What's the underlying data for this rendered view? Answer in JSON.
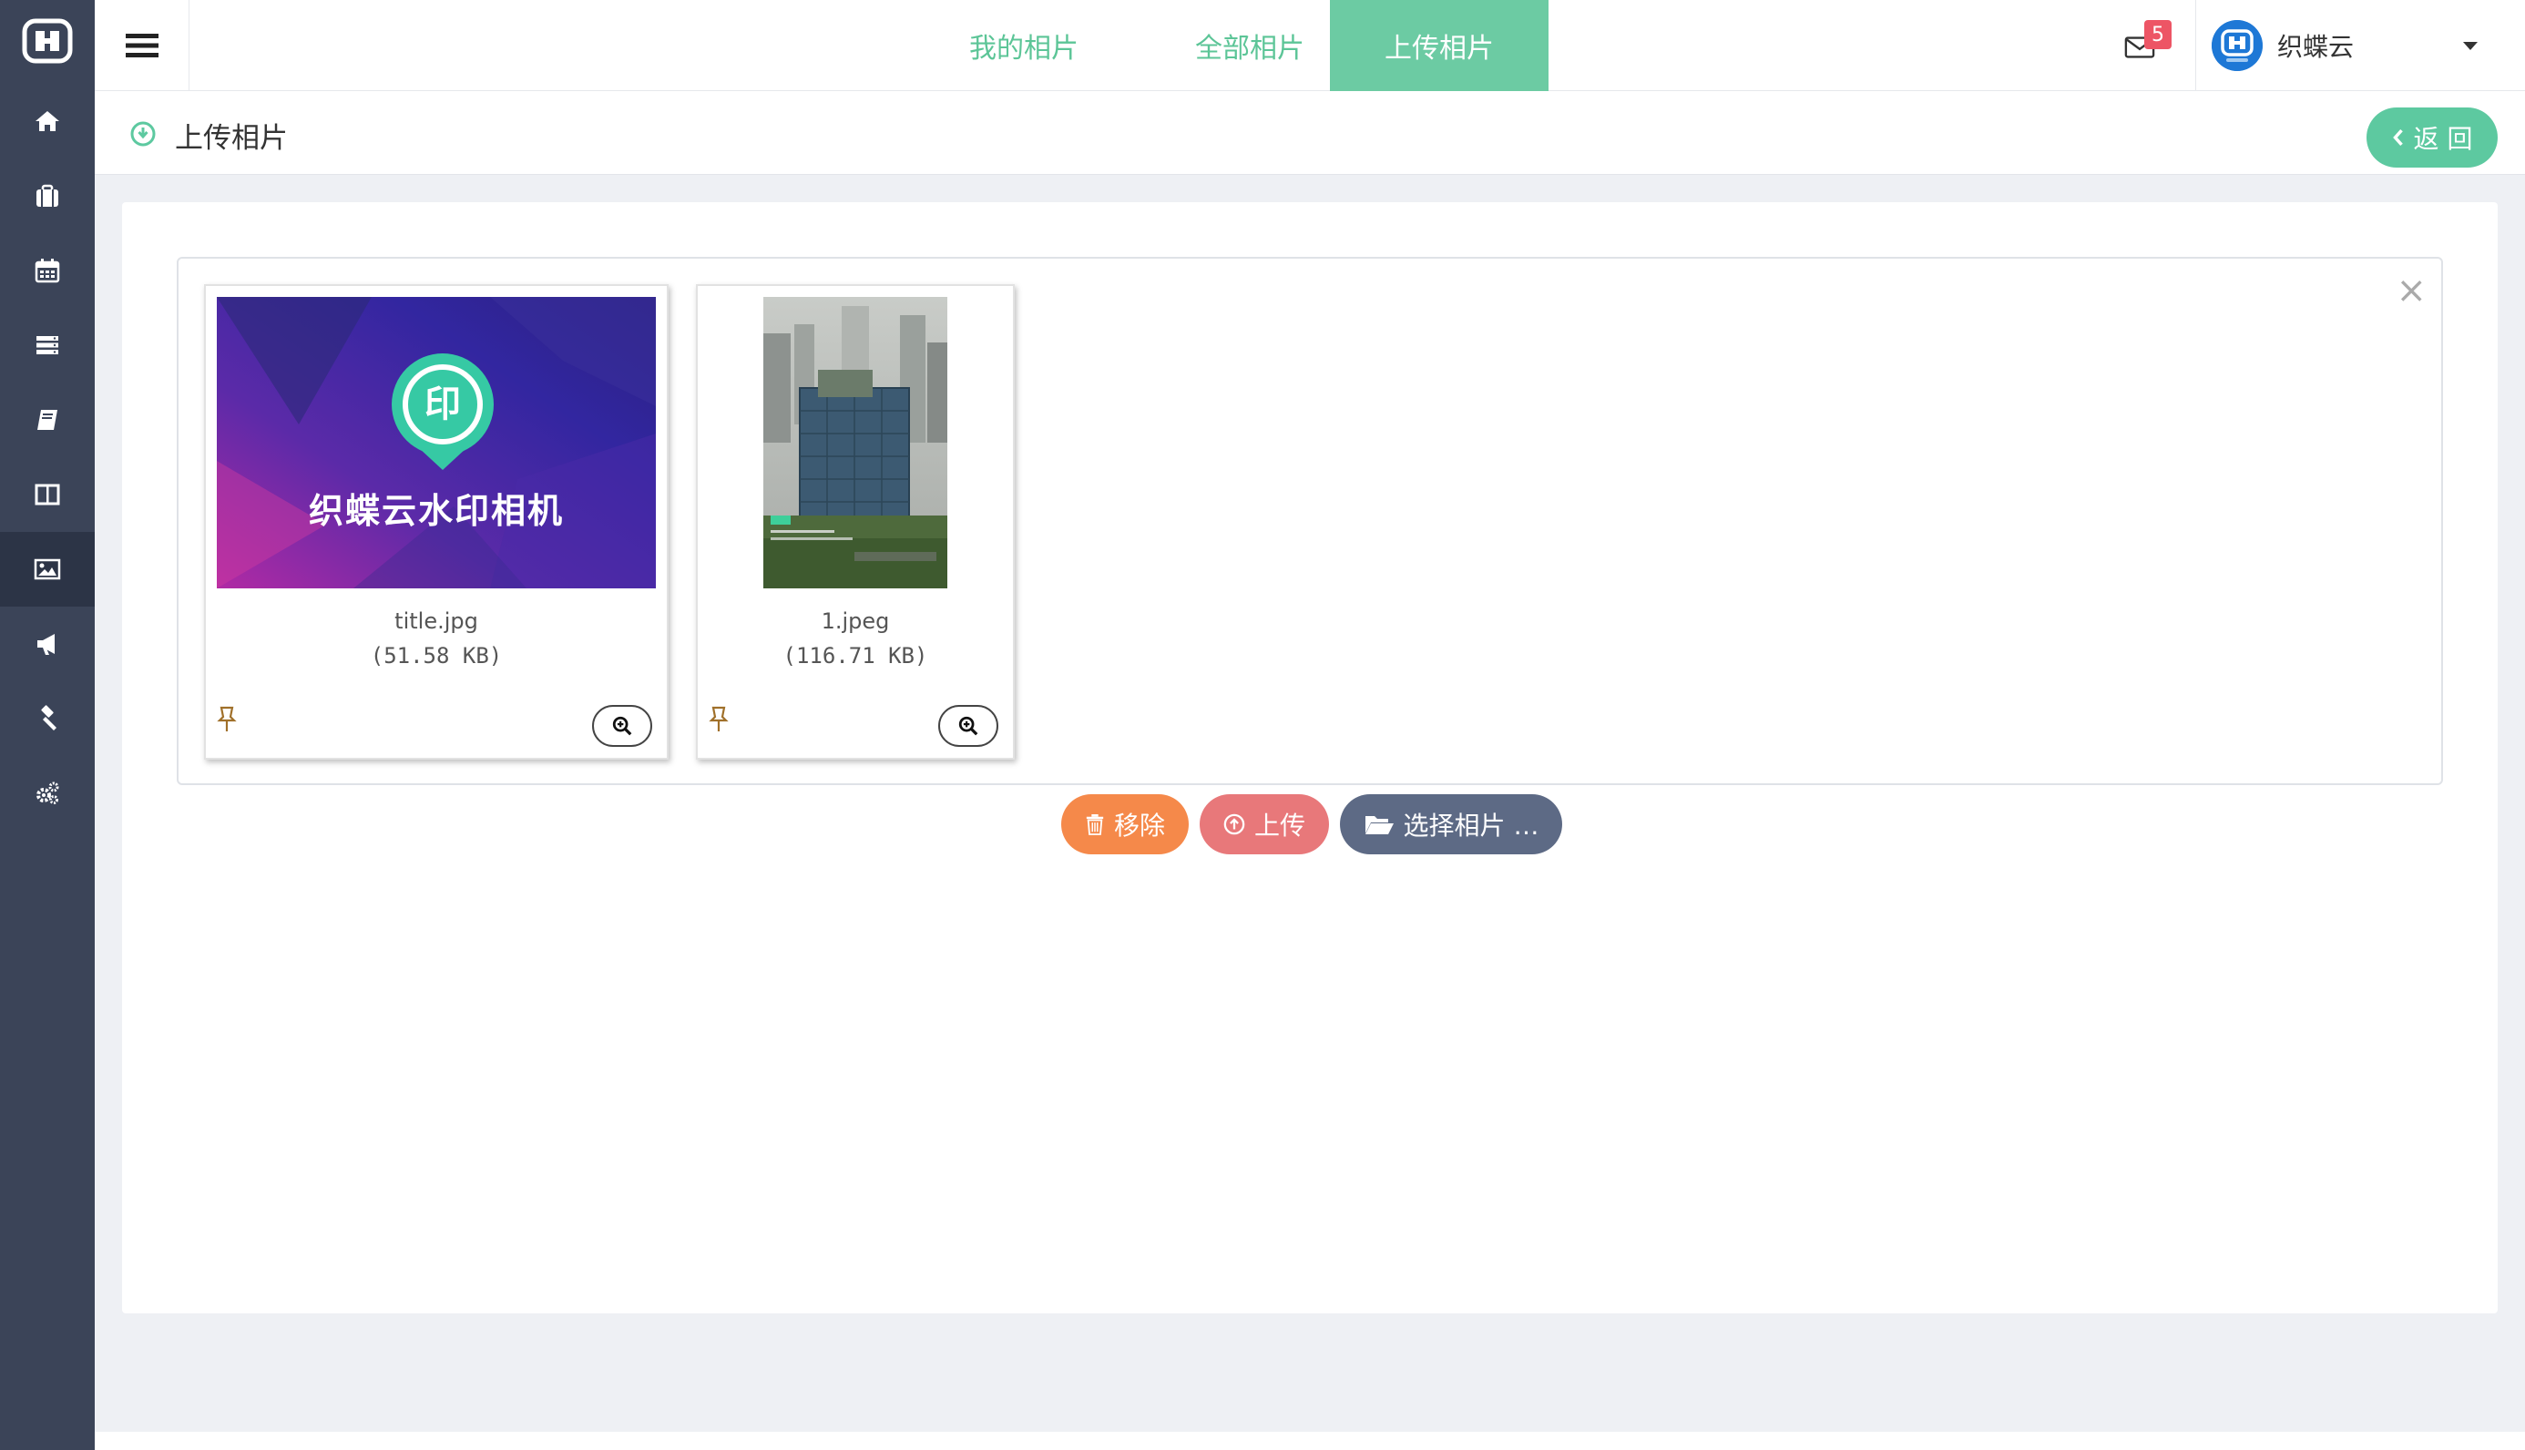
{
  "topbar": {
    "tabs": [
      {
        "label": "我的相片"
      },
      {
        "label": "全部相片"
      },
      {
        "label": "上传相片",
        "active": true
      }
    ],
    "mail_count": "5",
    "user_name": "织蝶云"
  },
  "subheader": {
    "title": "上传相片",
    "back_label": "返 回"
  },
  "sidebar": {
    "items": [
      "home-icon",
      "briefcase-icon",
      "calendar-icon",
      "server-icon",
      "book-icon",
      "columns-icon",
      "image-icon",
      "bullhorn-icon",
      "gavel-icon",
      "gears-icon"
    ],
    "active": "image-icon"
  },
  "files": [
    {
      "name": "title.jpg",
      "size": "(51.58 KB)",
      "poster_text": "织蝶云水印相机",
      "badge": "印"
    },
    {
      "name": "1.jpeg",
      "size": "(116.71 KB)"
    }
  ],
  "actions": {
    "remove": "移除",
    "upload": "上传",
    "choose": "选择相片 …"
  },
  "colors": {
    "sidebar": "#3b4458",
    "accent": "#5dc9a0",
    "remove": "#f5894a",
    "upload": "#e8787a",
    "choose": "#5d6a85"
  }
}
